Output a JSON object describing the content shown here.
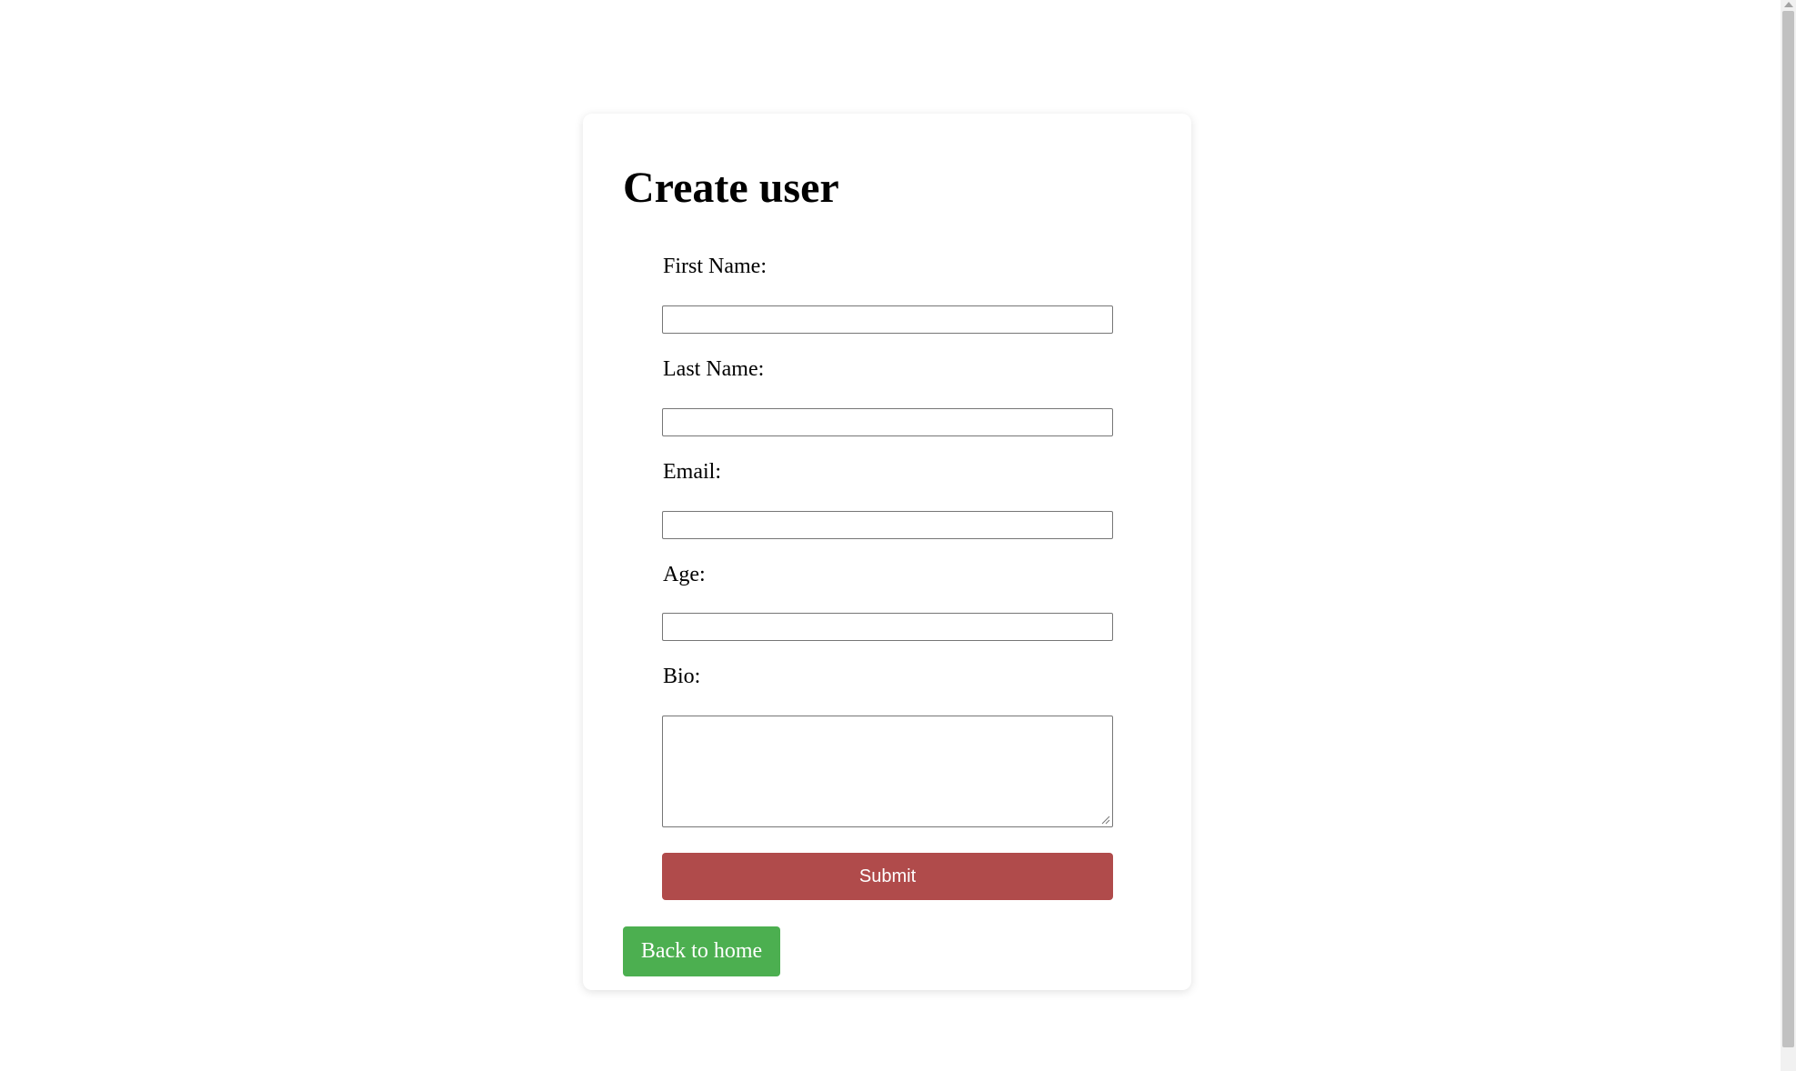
{
  "form": {
    "title": "Create user",
    "fields": [
      {
        "label": "First Name:",
        "value": "",
        "placeholder": ""
      },
      {
        "label": "Last Name:",
        "value": "",
        "placeholder": ""
      },
      {
        "label": "Email:",
        "value": "",
        "placeholder": ""
      },
      {
        "label": "Age:",
        "value": "",
        "placeholder": ""
      },
      {
        "label": "Bio:",
        "value": "",
        "placeholder": ""
      }
    ],
    "submit_label": "Submit",
    "back_label": "Back to home"
  },
  "colors": {
    "submit": "#b04b4b",
    "back": "#4caf50"
  }
}
